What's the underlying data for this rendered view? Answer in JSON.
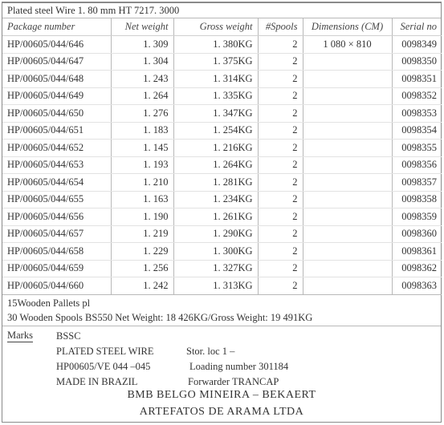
{
  "title": "Plated steel Wire 1. 80 mm HT   7217. 3000",
  "columns": [
    "Package number",
    "Net weight",
    "Gross weight",
    "#Spools",
    "Dimensions (CM)",
    "Serial no"
  ],
  "rows": [
    [
      "HP/00605/044/646",
      "1. 309",
      "1. 380KG",
      "2",
      "1 080 × 810",
      "0098349"
    ],
    [
      "HP/00605/044/647",
      "1. 304",
      "1. 375KG",
      "2",
      "",
      "0098350"
    ],
    [
      "HP/00605/044/648",
      "1. 243",
      "1. 314KG",
      "2",
      "",
      "0098351"
    ],
    [
      "HP/00605/044/649",
      "1. 264",
      "1. 335KG",
      "2",
      "",
      "0098352"
    ],
    [
      "HP/00605/044/650",
      "1. 276",
      "1. 347KG",
      "2",
      "",
      "0098353"
    ],
    [
      "HP/00605/044/651",
      "1. 183",
      "1. 254KG",
      "2",
      "",
      "0098354"
    ],
    [
      "HP/00605/044/652",
      "1. 145",
      "1. 216KG",
      "2",
      "",
      "0098355"
    ],
    [
      "HP/00605/044/653",
      "1. 193",
      "1. 264KG",
      "2",
      "",
      "0098356"
    ],
    [
      "HP/00605/044/654",
      "1. 210",
      "1. 281KG",
      "2",
      "",
      "0098357"
    ],
    [
      "HP/00605/044/655",
      "1. 163",
      "1. 234KG",
      "2",
      "",
      "0098358"
    ],
    [
      "HP/00605/044/656",
      "1. 190",
      "1. 261KG",
      "2",
      "",
      "0098359"
    ],
    [
      "HP/00605/044/657",
      "1. 219",
      "1. 290KG",
      "2",
      "",
      "0098360"
    ],
    [
      "HP/00605/044/658",
      "1. 229",
      "1. 300KG",
      "2",
      "",
      "0098361"
    ],
    [
      "HP/00605/044/659",
      "1. 256",
      "1. 327KG",
      "2",
      "",
      "0098362"
    ],
    [
      "HP/00605/044/660",
      "1. 242",
      "1. 313KG",
      "2",
      "",
      "0098363"
    ]
  ],
  "footer": {
    "pallets": "15Wooden Pallets pl",
    "spools": "30 Wooden Spools BS550   Net Weight: 18 426KG/Gross Weight: 19 491KG"
  },
  "marks": {
    "label": "Marks",
    "line1": "BSSC",
    "line2": "PLATED STEEL WIRE",
    "line3": "HP00605/VE 044 –045",
    "line4": "MADE IN BRAZIL",
    "stor_loc": "Stor. loc      1 –",
    "loading": "Loading number 301184",
    "forwarder": "Forwarder      TRANCAP"
  },
  "company": {
    "line1": "BMB BELGO MINEIRA – BEKAERT",
    "line2": "ARTEFATOS DE ARAMA LTDA"
  }
}
